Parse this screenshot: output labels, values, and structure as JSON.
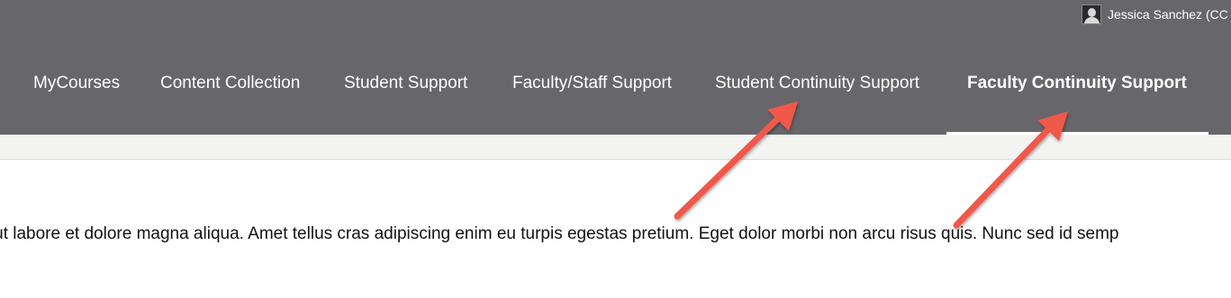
{
  "user": {
    "name": "Jessica Sanchez (CC",
    "avatar_icon": "user-avatar-icon"
  },
  "nav": {
    "items": [
      {
        "label": "MyCourses"
      },
      {
        "label": "Content Collection"
      },
      {
        "label": "Student Support"
      },
      {
        "label": "Faculty/Staff Support"
      },
      {
        "label": "Student Continuity Support"
      },
      {
        "label": "Faculty Continuity Support",
        "active": true
      }
    ]
  },
  "content": {
    "text": "nt ut labore et dolore magna aliqua. Amet tellus cras adipiscing enim eu turpis egestas pretium. Eget dolor morbi non arcu risus quis. Nunc sed id semp"
  },
  "colors": {
    "header_bg": "#67666b",
    "subbar_bg": "#f3f3f2",
    "annotation_arrow": "#f0584a"
  }
}
